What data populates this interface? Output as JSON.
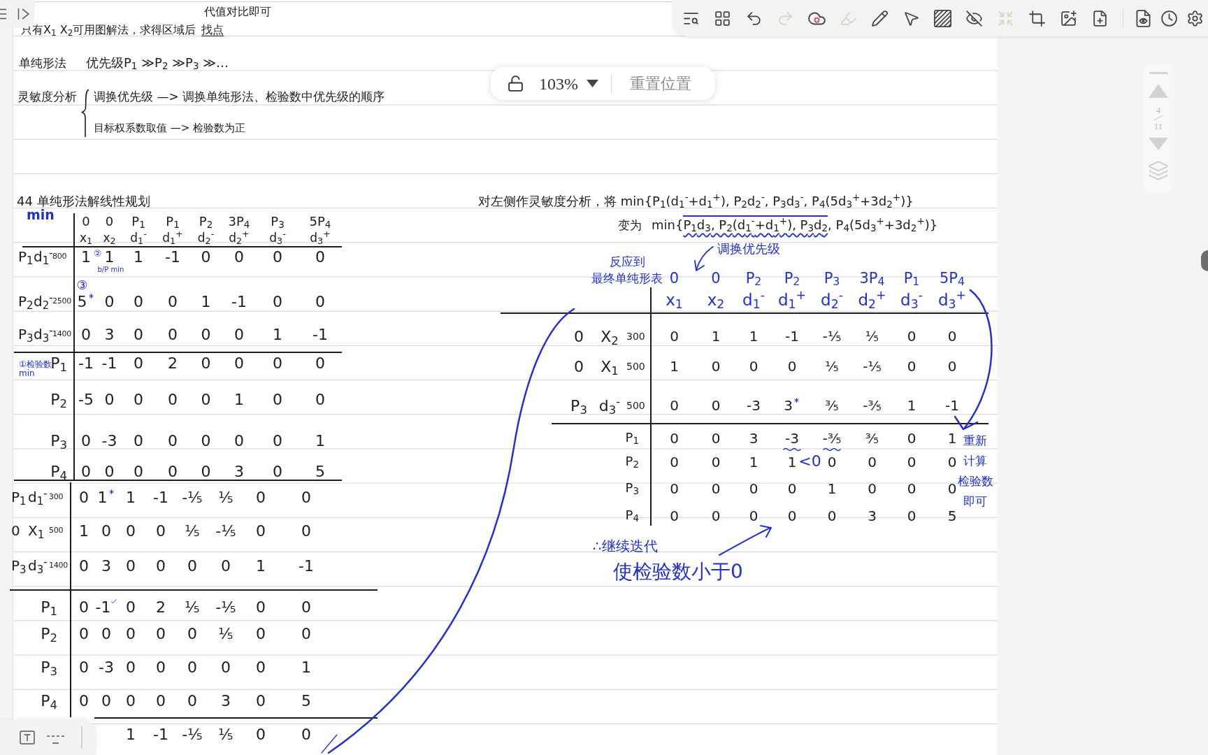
{
  "toolbar": {
    "tools": [
      {
        "kind": "search",
        "disabled": false
      },
      {
        "kind": "grid",
        "disabled": false
      },
      {
        "kind": "undo",
        "disabled": false
      },
      {
        "kind": "redo",
        "disabled": true
      },
      {
        "kind": "cloud",
        "disabled": false
      },
      {
        "kind": "highlighter",
        "disabled": true
      },
      {
        "kind": "pen",
        "disabled": false
      },
      {
        "kind": "pointer",
        "disabled": false
      },
      {
        "kind": "hatch",
        "disabled": false
      },
      {
        "kind": "hide",
        "disabled": false
      },
      {
        "kind": "shrink",
        "disabled": true
      },
      {
        "kind": "crop",
        "disabled": false
      },
      {
        "kind": "image",
        "disabled": false
      },
      {
        "kind": "page",
        "disabled": false
      }
    ],
    "view_tools": [
      {
        "kind": "preview",
        "disabled": false
      },
      {
        "kind": "history",
        "disabled": false
      },
      {
        "kind": "settings",
        "disabled": false
      }
    ]
  },
  "zoom_control": {
    "locked": false,
    "zoom": "103%",
    "reset_button": "重置位置"
  },
  "page_navigator": {
    "current_page": "4",
    "page_count": "11"
  },
  "notes": {
    "margin_note": "代值对比即可",
    "graphical_method": {
      "text": "只有X$_{1}$ X$_{2}$可用图解法，求得区域后",
      "underlined": "找点"
    },
    "simplex_method": {
      "label": "单纯形法",
      "text": "优先级P$_{1}$ ≫P$_{2}$ ≫P$_{3}$ ≫…"
    },
    "sensitivity_analysis": {
      "label": "灵敏度分析",
      "items": [
        "调换优先级 —> 调换单纯形法、检验数中优先级的顺序",
        "目标权系数取值 —> 检验数为正"
      ]
    }
  },
  "left_section": {
    "title": "44 单纯形法解线性规划",
    "note": "min",
    "tableaux": [
      {
        "columns": [
          {
            "coefficient": "0",
            "variable": "x$_{1}$"
          },
          {
            "coefficient": "0",
            "variable": "x$_{2}$"
          },
          {
            "coefficient": "P$_{1}$",
            "variable": "d$_{1}$$^{-}$"
          },
          {
            "coefficient": "P$_{1}$",
            "variable": "d$_{1}$$^{+}$"
          },
          {
            "coefficient": "P$_{2}$",
            "variable": "d$_{2}$$^{-}$"
          },
          {
            "coefficient": "3P$_{4}$",
            "variable": "d$_{2}$$^{+}$"
          },
          {
            "coefficient": "P$_{3}$",
            "variable": "d$_{3}$$^{-}$"
          },
          {
            "coefficient": "5P$_{4}$",
            "variable": "d$_{3}$$^{+}$"
          }
        ],
        "rows": [
          {
            "basis_coefficient": "P$_{1}$",
            "basis": "d$_{1}$$^{-}$",
            "value": "800",
            "cells": [
              "1",
              {
                "value": "1",
                "prefix": "②",
                "below": "b/P min"
              },
              "1",
              "-1",
              "0",
              "0",
              "0",
              "0"
            ]
          },
          {
            "basis_coefficient": "P$_{2}$",
            "basis": "d$_{2}$$^{-}$",
            "value": "2500",
            "cells": [
              {
                "value": "5",
                "above": "③",
                "starred": true
              },
              "0",
              "0",
              "0",
              "1",
              "-1",
              "0",
              "0"
            ]
          },
          {
            "basis_coefficient": "P$_{3}$",
            "basis": "d$_{3}$$^{-}$",
            "value": "1400",
            "cells": [
              "0",
              "3",
              "0",
              "0",
              "0",
              "0",
              "1",
              "-1"
            ]
          }
        ],
        "check_rows": [
          {
            "label": "P$_{1}$",
            "note": [
              "①检验数",
              "min"
            ],
            "cells": [
              "-1",
              "-1",
              "0",
              "2",
              "0",
              "0",
              "0",
              "0"
            ]
          },
          {
            "label": "P$_{2}$",
            "cells": [
              "-5",
              "0",
              "0",
              "0",
              "0",
              "1",
              "0",
              "0"
            ]
          },
          {
            "label": "P$_{3}$",
            "cells": [
              "0",
              "-3",
              "0",
              "0",
              "0",
              "0",
              "0",
              "1"
            ]
          },
          {
            "label": "P$_{4}$",
            "cells": [
              "0",
              "0",
              "0",
              "0",
              "0",
              "3",
              "0",
              "5"
            ]
          }
        ]
      },
      {
        "rows": [
          {
            "basis_coefficient": "P$_{1}$",
            "basis": "d$_{1}$$^{-}$",
            "value": "300",
            "cells": [
              "0",
              {
                "value": "1",
                "starred": true
              },
              "1",
              "-1",
              "-⅕",
              "⅕",
              "0",
              "0"
            ]
          },
          {
            "basis_coefficient": "0",
            "basis": "X$_{1}$",
            "value": "500",
            "cells": [
              "1",
              "0",
              "0",
              "0",
              "⅕",
              "-⅕",
              "0",
              "0"
            ]
          },
          {
            "basis_coefficient": "P$_{3}$",
            "basis": "d$_{3}$$^{-}$",
            "value": "1400",
            "cells": [
              "0",
              "3",
              "0",
              "0",
              "0",
              "0",
              "1",
              "-1"
            ]
          }
        ],
        "check_rows": [
          {
            "label": "P$_{1}$",
            "cells": [
              "0",
              {
                "value": "-1",
                "ticked": true
              },
              "0",
              "2",
              "⅕",
              "-⅕",
              "0",
              "0"
            ]
          },
          {
            "label": "P$_{2}$",
            "cells": [
              "0",
              "0",
              "0",
              "0",
              "0",
              "⅕",
              "0",
              "0"
            ]
          },
          {
            "label": "P$_{3}$",
            "cells": [
              "0",
              "-3",
              "0",
              "0",
              "0",
              "0",
              "0",
              "1"
            ]
          },
          {
            "label": "P$_{4}$",
            "cells": [
              "0",
              "0",
              "0",
              "0",
              "0",
              "3",
              "0",
              "5"
            ]
          }
        ],
        "partial_row": {
          "cells": [
            "1",
            "-1",
            "-⅕",
            "⅕",
            "0",
            "0"
          ]
        }
      }
    ]
  },
  "right_section": {
    "sentence": "对左侧作灵敏度分析，将 min{P$_{1}$(d$_{1}$$^{-}$+d$_{1}$$^{+}$), P$_{2}$d$_{2}$$^{-}$, P$_{3}$d$_{3}$$^{-}$, P$_{4}$(5d$_{3}$$^{+}$+3d$_{2}$$^{+}$)}",
    "becomes": {
      "label": "变为",
      "prefix": "min{",
      "changed": "P$_{1}$d$_{3}$, P$_{2}$(d$_{1}$$^{-}$+d$_{1}$$^{+}$), P$_{3}$d$_{2}$",
      "rest": ", P$_{4}$(5d$_{3}$$^{+}$+3d$_{2}$$^{+}$)}"
    },
    "swap_note": "调换优先级",
    "table_note": [
      "反应到",
      "最终单纯形表"
    ],
    "tableau": {
      "columns": [
        {
          "coefficient": "0",
          "variable": "x$_{1}$"
        },
        {
          "coefficient": "0",
          "variable": "x$_{2}$"
        },
        {
          "coefficient": "P$_{2}$",
          "variable": "d$_{1}$$^{-}$"
        },
        {
          "coefficient": "P$_{2}$",
          "variable": "d$_{1}$$^{+}$"
        },
        {
          "coefficient": "P$_{3}$",
          "variable": "d$_{2}$$^{-}$"
        },
        {
          "coefficient": "3P$_{4}$",
          "variable": "d$_{2}$$^{+}$"
        },
        {
          "coefficient": "P$_{1}$",
          "variable": "d$_{3}$$^{-}$"
        },
        {
          "coefficient": "5P$_{4}$",
          "variable": "d$_{3}$$^{+}$"
        }
      ],
      "rows": [
        {
          "basis_coefficient": "0",
          "basis": "X$_{2}$",
          "value": "300",
          "cells": [
            "0",
            "1",
            "1",
            "-1",
            "-⅕",
            "⅕",
            "0",
            "0"
          ]
        },
        {
          "basis_coefficient": "0",
          "basis": "X$_{1}$",
          "value": "500",
          "cells": [
            "1",
            "0",
            "0",
            "0",
            "⅕",
            "-⅕",
            "0",
            "0"
          ]
        },
        {
          "basis_coefficient": "P$_{3}$",
          "basis": "d$_{3}$$^{-}$",
          "value": "500",
          "cells": [
            "0",
            "0",
            "-3",
            {
              "value": "3",
              "starred": true
            },
            "⅗",
            "-⅗",
            "1",
            "-1"
          ]
        }
      ],
      "check_rows": [
        {
          "label": "P$_{1}$",
          "cells": [
            "0",
            "0",
            "3",
            {
              "value": "-3",
              "wavy_underline": true
            },
            {
              "value": "-⅗",
              "wavy_underline": true
            },
            "⅗",
            "0",
            "1"
          ]
        },
        {
          "label": "P$_{2}$",
          "cells": [
            "0",
            "0",
            "1",
            {
              "value": "1",
              "suffix": "<0"
            },
            "0",
            "0",
            "0",
            "0"
          ]
        },
        {
          "label": "P$_{3}$",
          "cells": [
            "0",
            "0",
            "0",
            "0",
            "1",
            "0",
            "0",
            "0"
          ]
        },
        {
          "label": "P$_{4}$",
          "cells": [
            "0",
            "0",
            "0",
            "0",
            "0",
            "3",
            "0",
            "5"
          ]
        }
      ]
    },
    "recompute_note": [
      "重新",
      "计算",
      "检验数",
      "即可"
    ],
    "conclusion": [
      "∴继续迭代",
      "使检验数小于0"
    ]
  }
}
